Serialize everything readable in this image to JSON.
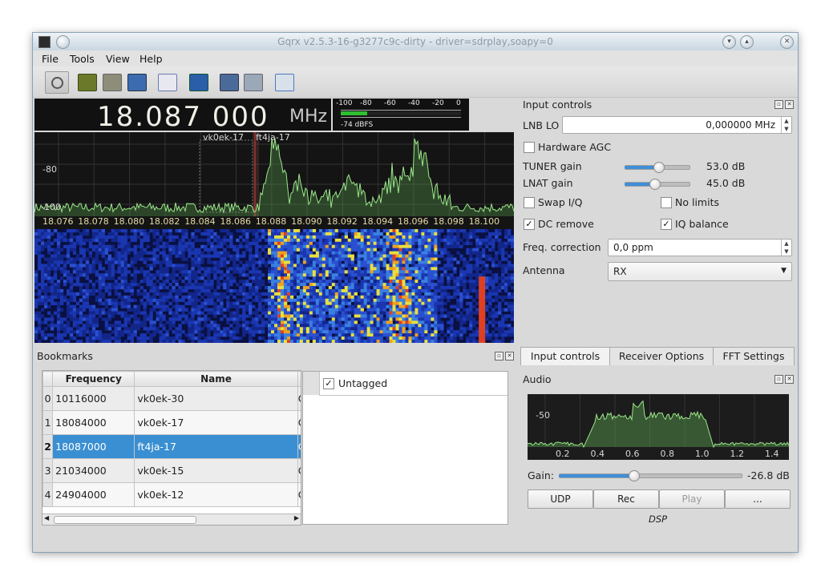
{
  "window": {
    "title": "Gqrx v2.5.3-16-g3277c9c-dirty - driver=sdrplay,soapy=0"
  },
  "menu": {
    "items": [
      "File",
      "Tools",
      "View",
      "Help"
    ]
  },
  "frequency": {
    "value": "18.087 000",
    "unit": "MHz"
  },
  "meter": {
    "scale": [
      "-100",
      "-80",
      "-60",
      "-40",
      "-20",
      "0"
    ],
    "reading": "-74 dBFS",
    "level_fraction": 0.22
  },
  "spectrum": {
    "y_labels": [
      "-80",
      "-100"
    ],
    "x_labels": [
      "18.076",
      "18.078",
      "18.080",
      "18.082",
      "18.084",
      "18.086",
      "18.088",
      "18.090",
      "18.092",
      "18.094",
      "18.096",
      "18.098",
      "18.100"
    ],
    "markers": [
      "vk0ek-17",
      "ft4ja-17"
    ]
  },
  "input_controls": {
    "title": "Input controls",
    "lnb_label": "LNB LO",
    "lnb_value": "0,000000 MHz",
    "hardware_agc": "Hardware AGC",
    "tuner_label": "TUNER gain",
    "tuner_value": "53.0 dB",
    "tuner_fraction": 0.52,
    "lnat_label": "LNAT gain",
    "lnat_value": "45.0 dB",
    "lnat_fraction": 0.46,
    "swap_iq": "Swap I/Q",
    "no_limits": "No limits",
    "dc_remove": "DC remove",
    "iq_balance": "IQ balance",
    "freq_corr_label": "Freq. correction",
    "freq_corr_value": "0,0 ppm",
    "antenna_label": "Antenna",
    "antenna_value": "RX"
  },
  "bookmarks": {
    "title": "Bookmarks",
    "headers": [
      "Frequency",
      "Name"
    ],
    "rows": [
      {
        "index": "0",
        "frequency": "10116000",
        "name": "vk0ek-30",
        "extra": "C"
      },
      {
        "index": "1",
        "frequency": "18084000",
        "name": "vk0ek-17",
        "extra": "C"
      },
      {
        "index": "2",
        "frequency": "18087000",
        "name": "ft4ja-17",
        "extra": "C"
      },
      {
        "index": "3",
        "frequency": "21034000",
        "name": "vk0ek-15",
        "extra": "C"
      },
      {
        "index": "4",
        "frequency": "24904000",
        "name": "vk0ek-12",
        "extra": "C"
      }
    ],
    "tag": "Untagged"
  },
  "tabs": [
    "Input controls",
    "Receiver Options",
    "FFT Settings"
  ],
  "audio": {
    "title": "Audio",
    "y_label": "-50",
    "x_labels": [
      "0.2",
      "0.4",
      "0.6",
      "0.8",
      "1.0",
      "1.2",
      "1.4"
    ],
    "gain_label": "Gain:",
    "gain_value": "-26.8 dB",
    "gain_fraction": 0.41,
    "buttons": [
      "UDP",
      "Rec",
      "Play",
      "..."
    ],
    "dsp": "DSP"
  },
  "colors": {
    "accent": "#3f8fd8",
    "spectrum_line": "#9be88a",
    "selected_row": "#3a8fd2"
  }
}
